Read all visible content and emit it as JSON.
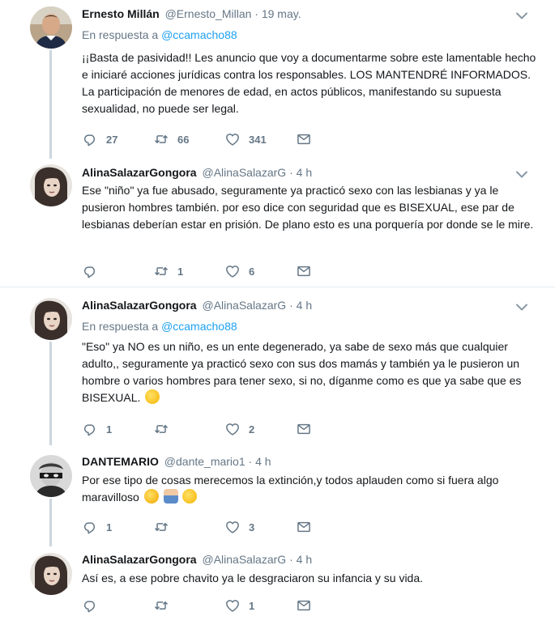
{
  "tweets": [
    {
      "name": "Ernesto Millán",
      "handle": "@Ernesto_Millan",
      "dot": "·",
      "time": "19 may.",
      "reply_label": "En respuesta a",
      "reply_to": "@ccamacho88",
      "text": "¡¡Basta de pasividad!! Les anuncio que voy a documentarme sobre este lamentable hecho e iniciaré acciones jurídicas contra los responsables. LOS MANTENDRÉ INFORMADOS. La participación de menores de edad, en actos públicos, manifestando su supuesta sexualidad, no puede ser legal.",
      "replies": "27",
      "retweets": "66",
      "likes": "341"
    },
    {
      "name": "AlinaSalazarGongora",
      "handle": "@AlinaSalazarG",
      "dot": "·",
      "time": "4 h",
      "text": "Ese \"niño\" ya fue abusado, seguramente ya practicó sexo con las lesbianas y ya le pusieron hombres también. por eso dice con seguridad que es BISEXUAL, ese par de lesbianas deberían estar en prisión. De plano esto es una porquería por donde se le mire.",
      "replies": "",
      "retweets": "1",
      "likes": "6"
    },
    {
      "name": "AlinaSalazarGongora",
      "handle": "@AlinaSalazarG",
      "dot": "·",
      "time": "4 h",
      "reply_label": "En respuesta a",
      "reply_to": "@ccamacho88",
      "text": "\"Eso\" ya NO es un niño, es un ente degenerado, ya sabe de sexo más que cualquier adulto,, seguramente ya practicó sexo con sus dos mamás y también ya le pusieron un hombre o varios hombres para tener sexo, si no, díganme como es que ya sabe que es BISEXUAL.",
      "replies": "1",
      "retweets": "",
      "likes": "2"
    },
    {
      "name": "DANTEMARIO",
      "handle": "@dante_mario1",
      "dot": "·",
      "time": "4 h",
      "text": "Por ese tipo de cosas merecemos la extinción,y todos aplauden como si fuera algo maravilloso",
      "replies": "1",
      "retweets": "",
      "likes": "3"
    },
    {
      "name": "AlinaSalazarGongora",
      "handle": "@AlinaSalazarG",
      "dot": "·",
      "time": "4 h",
      "text": "Así es, a ese pobre chavito ya le desgraciaron su infancia y su vida.",
      "replies": "",
      "retweets": "",
      "likes": "1"
    }
  ],
  "icons": [
    "reply-icon",
    "retweet-icon",
    "like-icon",
    "message-icon",
    "caret-down-icon"
  ],
  "colors": {
    "link": "#1da1f2",
    "muted": "#657786",
    "thread_line": "#ccd6dd",
    "divider": "#e6ecf0"
  }
}
